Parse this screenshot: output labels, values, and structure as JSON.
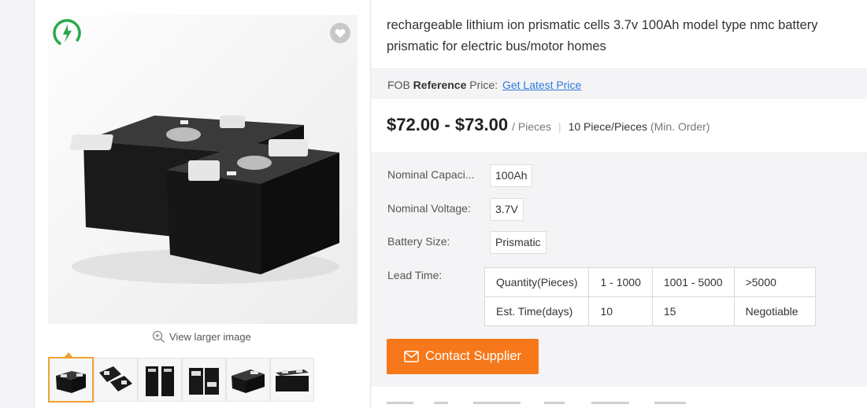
{
  "gallery": {
    "view_larger": "View larger image",
    "thumbnail_count": 6,
    "active_thumbnail": 0,
    "colors": {
      "active_border": "#f0a232",
      "logo_green": "#2aa84a"
    }
  },
  "product": {
    "title": "rechargeable lithium ion prismatic cells 3.7v 100Ah model type nmc battery prismatic for electric bus/motor homes",
    "fob_prefix": "FOB",
    "fob_reference": "Reference",
    "fob_price_label": "Price:",
    "fob_link": "Get Latest Price",
    "price_range": "$72.00 - $73.00",
    "price_unit": "/ Pieces",
    "separator": "|",
    "min_order": "10 Piece/Pieces",
    "min_order_note": "(Min. Order)"
  },
  "properties": [
    {
      "label": "Nominal Capaci...",
      "value": "100Ah"
    },
    {
      "label": "Nominal Voltage:",
      "value": "3.7V"
    },
    {
      "label": "Battery Size:",
      "value": "Prismatic"
    }
  ],
  "lead_time": {
    "label": "Lead Time:",
    "header": [
      "Quantity(Pieces)",
      "1 - 1000",
      "1001 - 5000",
      ">5000"
    ],
    "row": [
      "Est. Time(days)",
      "10",
      "15",
      "Negotiable"
    ]
  },
  "contact_button": {
    "label": "Contact Supplier",
    "color": "#f6781a"
  },
  "colors": {
    "link": "#2e7bd6",
    "band": "#f4f4f6"
  }
}
